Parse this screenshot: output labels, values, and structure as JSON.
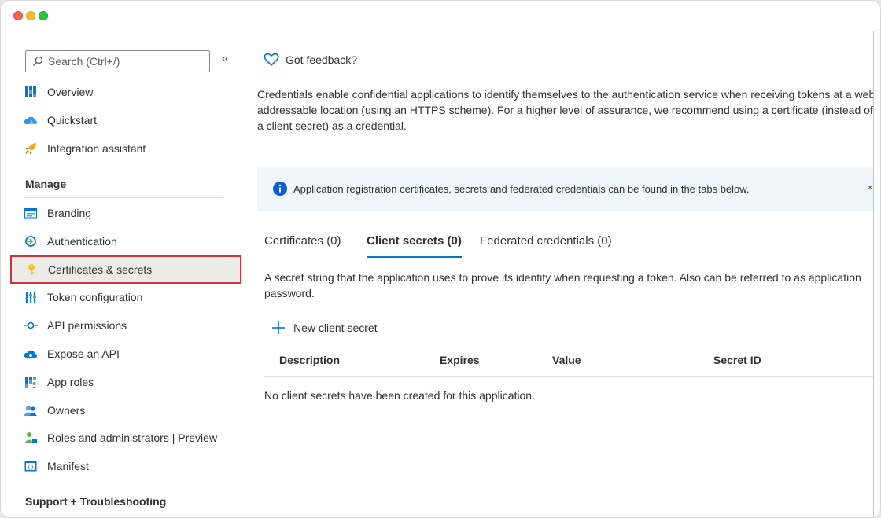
{
  "sidebar": {
    "search_placeholder": "Search (Ctrl+/)",
    "collapse_glyph": "«",
    "top_items": [
      {
        "label": "Overview",
        "icon": "overview-grid-icon"
      },
      {
        "label": "Quickstart",
        "icon": "cloud-icon"
      },
      {
        "label": "Integration assistant",
        "icon": "rocket-icon"
      }
    ],
    "manage_label": "Manage",
    "manage_items": [
      {
        "label": "Branding",
        "icon": "branding-icon"
      },
      {
        "label": "Authentication",
        "icon": "authentication-icon"
      },
      {
        "label": "Certificates & secrets",
        "icon": "key-icon",
        "selected": true
      },
      {
        "label": "Token configuration",
        "icon": "token-bars-icon"
      },
      {
        "label": "API permissions",
        "icon": "api-permissions-icon"
      },
      {
        "label": "Expose an API",
        "icon": "cloud-api-icon"
      },
      {
        "label": "App roles",
        "icon": "app-roles-icon"
      },
      {
        "label": "Owners",
        "icon": "owners-icon"
      },
      {
        "label": "Roles and administrators | Preview",
        "icon": "roles-admin-icon"
      },
      {
        "label": "Manifest",
        "icon": "manifest-icon"
      }
    ],
    "support_label": "Support + Troubleshooting"
  },
  "main": {
    "feedback_label": "Got feedback?",
    "description": "Credentials enable confidential applications to identify themselves to the authentication service when receiving tokens at a web addressable location (using an HTTPS scheme). For a higher level of assurance, we recommend using a certificate (instead of a client secret) as a credential.",
    "info_text": "Application registration certificates, secrets and federated credentials can be found in the tabs below.",
    "info_close": "×",
    "tabs": [
      {
        "label": "Certificates (0)"
      },
      {
        "label": "Client secrets (0)",
        "active": true
      },
      {
        "label": "Federated credentials (0)"
      }
    ],
    "secret_description": "A secret string that the application uses to prove its identity when requesting a token. Also can be referred to as application password.",
    "new_secret_label": "New client secret",
    "columns": [
      "Description",
      "Expires",
      "Value",
      "Secret ID"
    ],
    "empty_message": "No client secrets have been created for this application."
  },
  "colors": {
    "accent": "#0078d4",
    "selected_border": "#d13438",
    "info_background": "#eff6fc"
  }
}
